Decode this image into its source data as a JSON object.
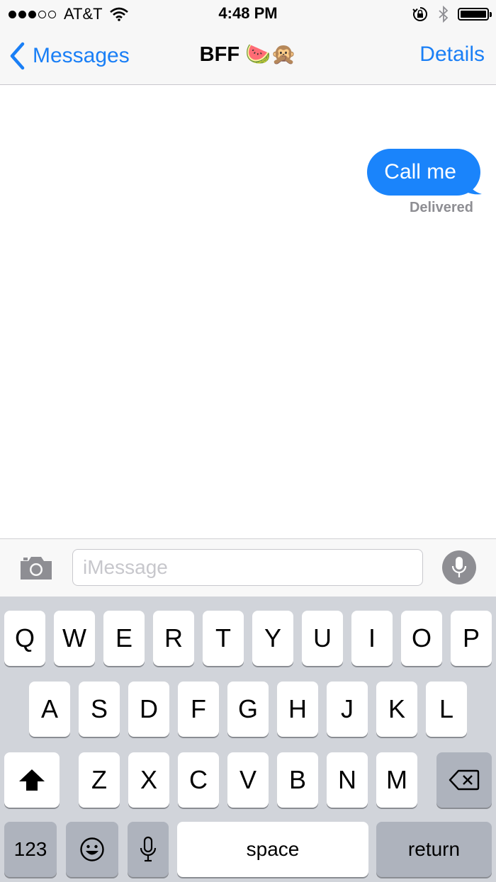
{
  "status_bar": {
    "carrier": "AT&T",
    "time": "4:48 PM"
  },
  "nav": {
    "back_label": "Messages",
    "title": "BFF 🍉🙊",
    "details_label": "Details"
  },
  "conversation": {
    "messages": [
      {
        "text": "Call me",
        "status": "Delivered"
      }
    ]
  },
  "composer": {
    "placeholder": "iMessage"
  },
  "keyboard": {
    "row1": [
      "Q",
      "W",
      "E",
      "R",
      "T",
      "Y",
      "U",
      "I",
      "O",
      "P"
    ],
    "row2": [
      "A",
      "S",
      "D",
      "F",
      "G",
      "H",
      "J",
      "K",
      "L"
    ],
    "row3": [
      "Z",
      "X",
      "C",
      "V",
      "B",
      "N",
      "M"
    ],
    "numbers_label": "123",
    "space_label": "space",
    "return_label": "return"
  },
  "colors": {
    "accent": "#1a7ff6",
    "bubble": "#1a84fb",
    "keyboard_bg": "#d1d4da"
  },
  "icons": [
    "back-chevron-icon",
    "wifi-icon",
    "orientation-lock-icon",
    "bluetooth-icon",
    "battery-icon",
    "camera-icon",
    "microphone-icon",
    "shift-icon",
    "backspace-icon",
    "emoji-icon"
  ]
}
